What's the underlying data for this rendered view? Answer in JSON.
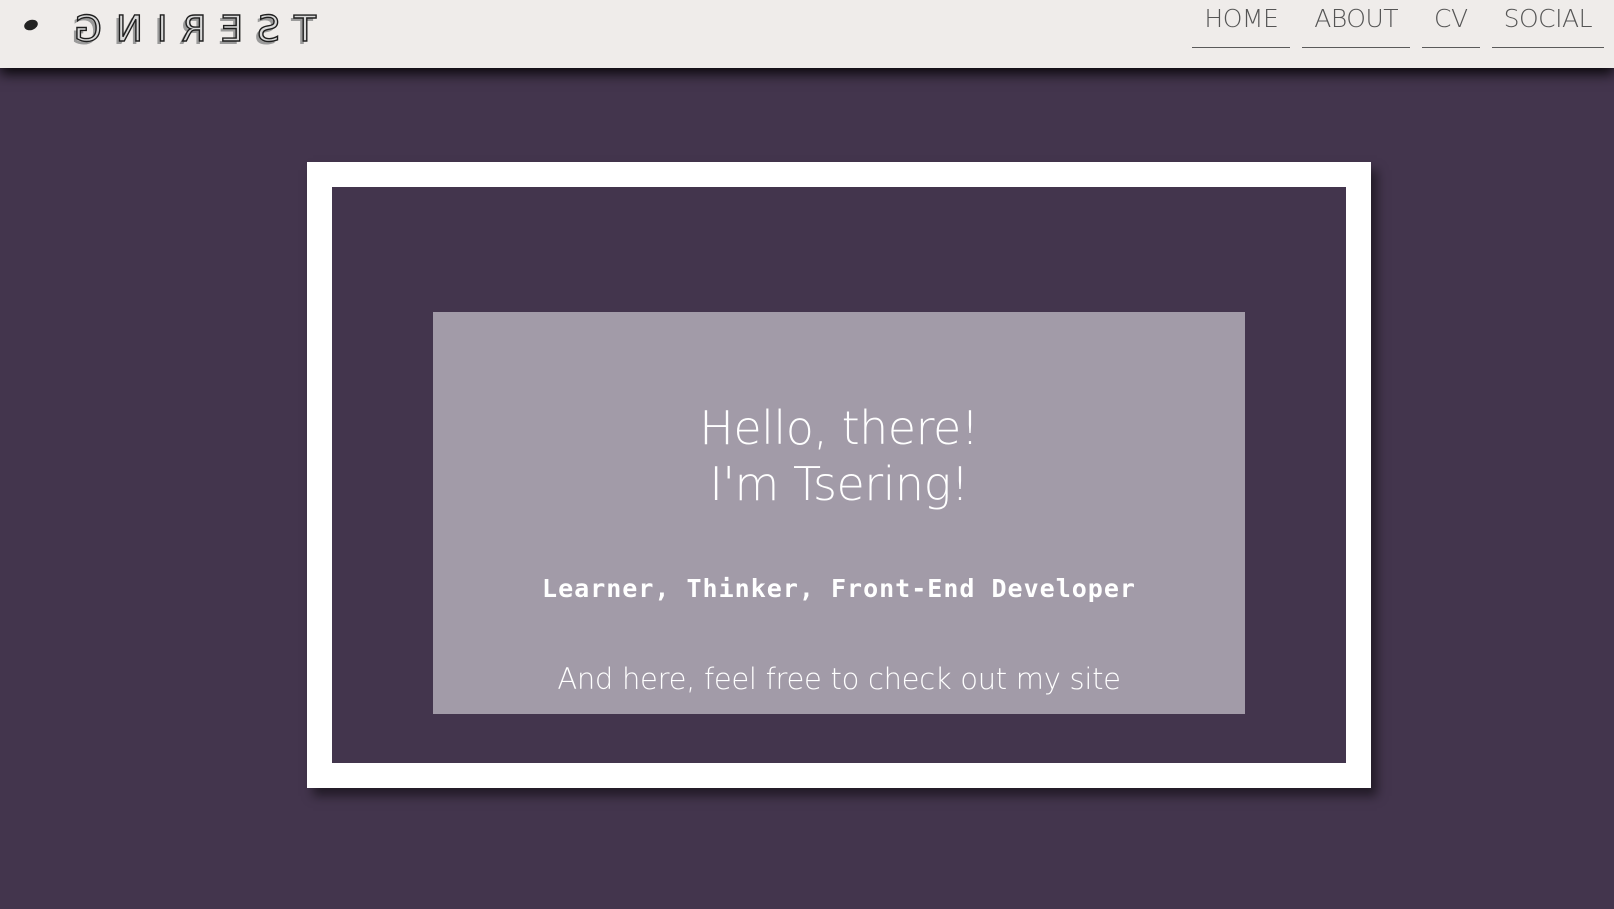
{
  "header": {
    "logo_text": "TSERING",
    "nav": [
      {
        "label": "HOME"
      },
      {
        "label": "ABOUT"
      },
      {
        "label": "CV"
      },
      {
        "label": "SOCIAL"
      }
    ]
  },
  "hero": {
    "greeting_line1": "Hello, there!",
    "greeting_line2": "I'm Tsering!",
    "tagline": "Learner, Thinker, Front-End Developer",
    "intro": "And here, feel free to check out my site"
  },
  "colors": {
    "background": "#43354d",
    "header_bg": "#efecea",
    "panel_bg": "#a29ba8",
    "frame": "#ffffff"
  }
}
